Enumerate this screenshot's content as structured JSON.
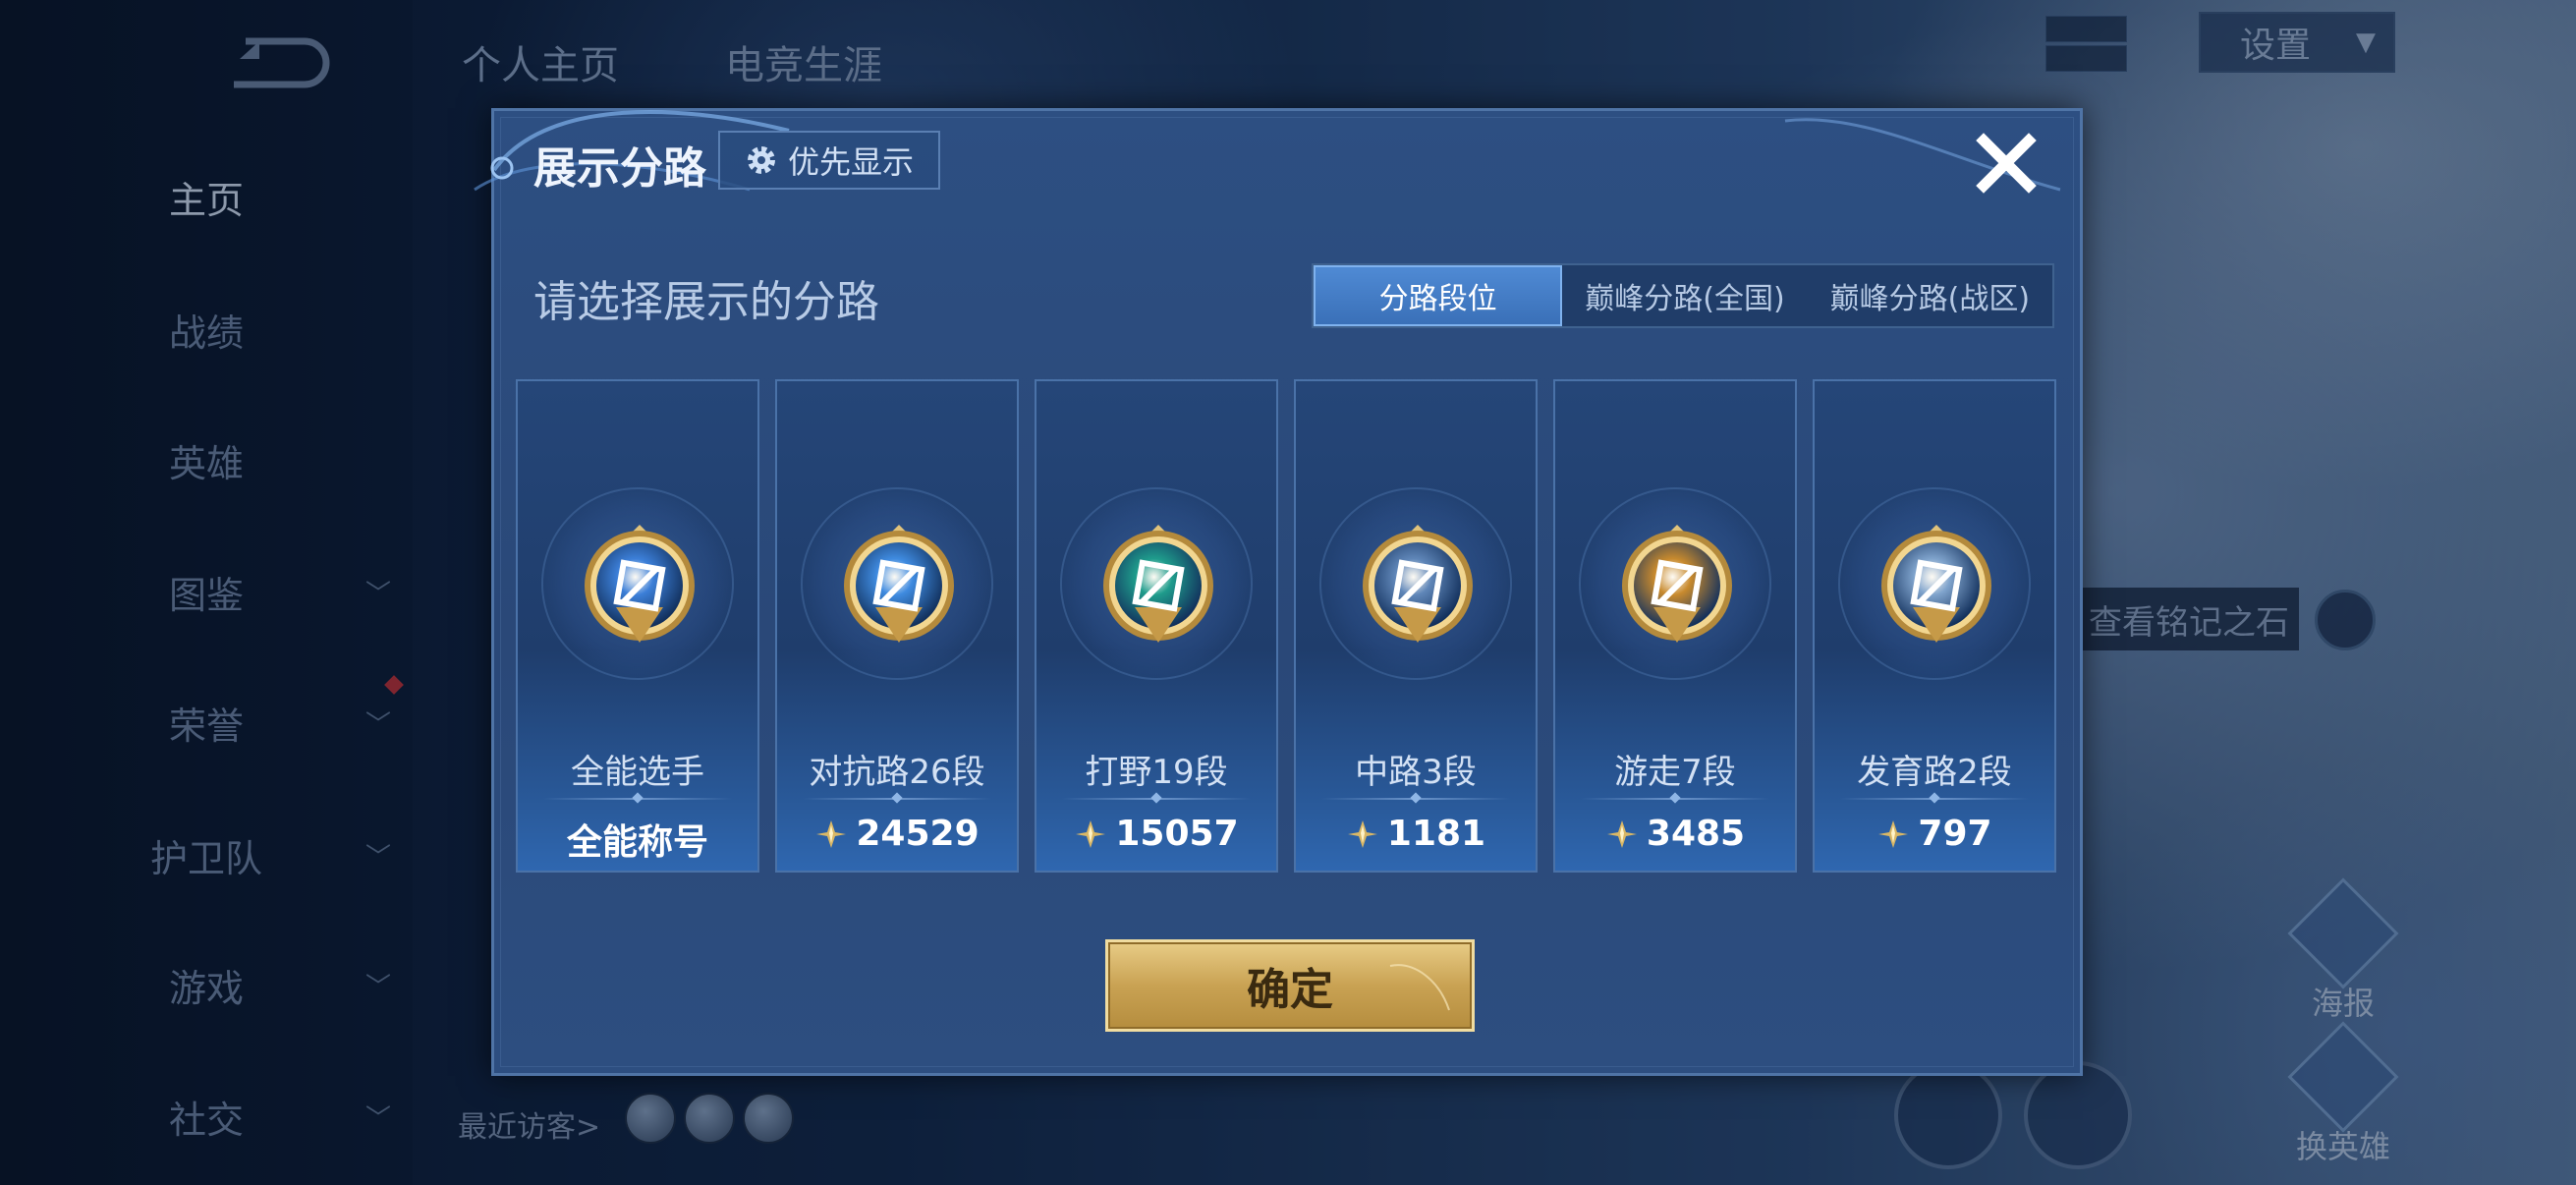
{
  "sidebar": {
    "items": [
      {
        "label": "主页",
        "has_chevron": false,
        "active": true
      },
      {
        "label": "战绩",
        "has_chevron": false,
        "active": false
      },
      {
        "label": "英雄",
        "has_chevron": false,
        "active": false
      },
      {
        "label": "图鉴",
        "has_chevron": true,
        "active": false
      },
      {
        "label": "荣誉",
        "has_chevron": true,
        "active": false
      },
      {
        "label": "护卫队",
        "has_chevron": true,
        "active": false
      },
      {
        "label": "游戏",
        "has_chevron": true,
        "active": false
      },
      {
        "label": "社交",
        "has_chevron": true,
        "active": false
      }
    ]
  },
  "header": {
    "tabs": [
      "个人主页",
      "电竞生涯"
    ],
    "settings_label": "设置"
  },
  "background": {
    "rune_label": "查看铭记之石",
    "poster_label": "海报",
    "change_hero_label": "换英雄",
    "recent_visitors_label": "最近访客>"
  },
  "modal": {
    "title": "展示分路",
    "priority_label": "优先显示",
    "subtitle": "请选择展示的分路",
    "tabs": [
      {
        "label": "分路段位",
        "active": true
      },
      {
        "label": "巅峰分路(全国)",
        "active": false
      },
      {
        "label": "巅峰分路(战区)",
        "active": false
      }
    ],
    "cards": [
      {
        "name": "全能选手",
        "value": "全能称号",
        "show_points_icon": false,
        "badge": "allround-badge-icon",
        "color": "#3c7fd8"
      },
      {
        "name": "对抗路26段",
        "value": "24529",
        "show_points_icon": true,
        "badge": "clash-lane-badge-icon",
        "color": "#3f8be0"
      },
      {
        "name": "打野19段",
        "value": "15057",
        "show_points_icon": true,
        "badge": "jungle-dragon-badge-icon",
        "color": "#1f9c8c"
      },
      {
        "name": "中路3段",
        "value": "1181",
        "show_points_icon": true,
        "badge": "mid-lane-badge-icon",
        "color": "#5f86b8"
      },
      {
        "name": "游走7段",
        "value": "3485",
        "show_points_icon": true,
        "badge": "roam-wings-badge-icon",
        "color": "#c88a2e"
      },
      {
        "name": "发育路2段",
        "value": "797",
        "show_points_icon": true,
        "badge": "farm-lane-badge-icon",
        "color": "#7fa3cc"
      }
    ],
    "confirm_label": "确定"
  }
}
